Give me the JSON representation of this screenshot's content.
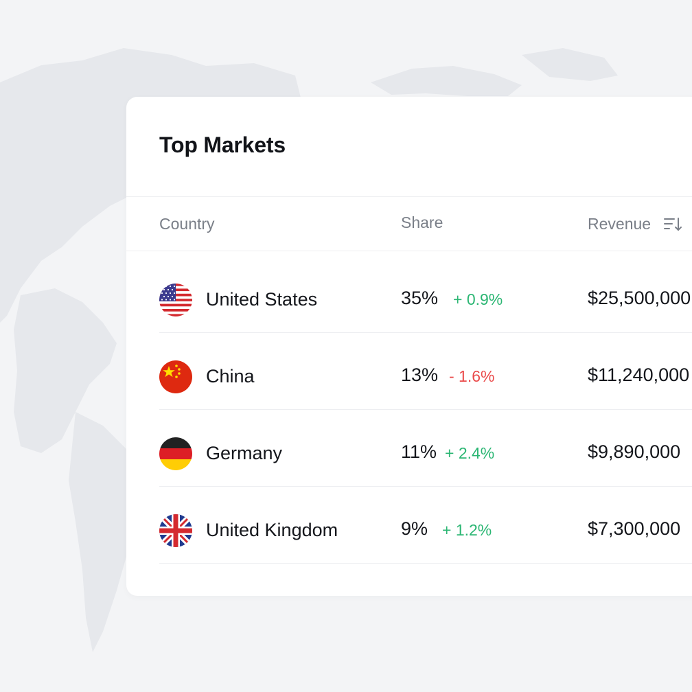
{
  "card": {
    "title": "Top Markets"
  },
  "table": {
    "columns": {
      "country": "Country",
      "share": "Share",
      "revenue": "Revenue"
    },
    "sort_icon": "sort-descending-icon",
    "rows": [
      {
        "country": "United States",
        "flag": "us-flag-icon",
        "share": "35%",
        "delta": "+ 0.9%",
        "trend": "up",
        "revenue": "$25,500,000"
      },
      {
        "country": "China",
        "flag": "cn-flag-icon",
        "share": "13%",
        "delta": "- 1.6%",
        "trend": "down",
        "revenue": "$11,240,000"
      },
      {
        "country": "Germany",
        "flag": "de-flag-icon",
        "share": "11%",
        "delta": "+ 2.4%",
        "trend": "up",
        "revenue": "$9,890,000"
      },
      {
        "country": "United Kingdom",
        "flag": "gb-flag-icon",
        "share": "9%",
        "delta": "+ 1.2%",
        "trend": "up",
        "revenue": "$7,300,000"
      }
    ]
  },
  "colors": {
    "positive": "#2bb673",
    "negative": "#ea4a4a",
    "background": "#f3f4f6"
  }
}
